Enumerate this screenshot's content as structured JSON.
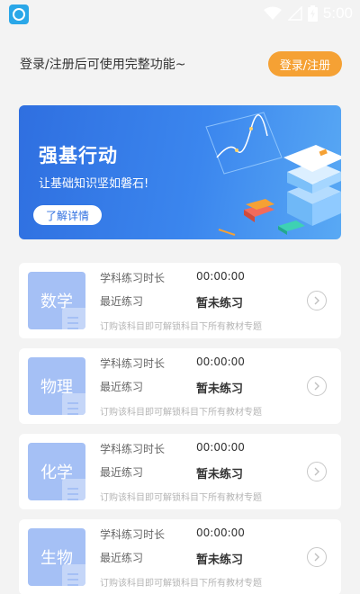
{
  "status_bar": {
    "time": "5:00",
    "icons": [
      "app-icon",
      "wifi-icon",
      "signal-icon",
      "battery-icon"
    ]
  },
  "login": {
    "prompt": "登录/注册后可使用完整功能~",
    "button_label": "登录/注册"
  },
  "banner": {
    "title": "强基行动",
    "subtitle": "让基础知识坚如磐石!",
    "button_label": "了解详情"
  },
  "subjects": [
    {
      "name": "数学",
      "duration_label": "学科练习时长",
      "duration_value": "00:00:00",
      "recent_label": "最近练习",
      "recent_value": "暂未练习",
      "hint": "订购该科目即可解锁科目下所有教材专题"
    },
    {
      "name": "物理",
      "duration_label": "学科练习时长",
      "duration_value": "00:00:00",
      "recent_label": "最近练习",
      "recent_value": "暂未练习",
      "hint": "订购该科目即可解锁科目下所有教材专题"
    },
    {
      "name": "化学",
      "duration_label": "学科练习时长",
      "duration_value": "00:00:00",
      "recent_label": "最近练习",
      "recent_value": "暂未练习",
      "hint": "订购该科目即可解锁科目下所有教材专题"
    },
    {
      "name": "生物",
      "duration_label": "学科练习时长",
      "duration_value": "00:00:00",
      "recent_label": "最近练习",
      "recent_value": "暂未练习",
      "hint": "订购该科目即可解锁科目下所有教材专题"
    }
  ],
  "colors": {
    "accent_orange": "#f5a134",
    "banner_blue": "#2f6fe0",
    "thumb_blue": "#a5c0f5"
  }
}
